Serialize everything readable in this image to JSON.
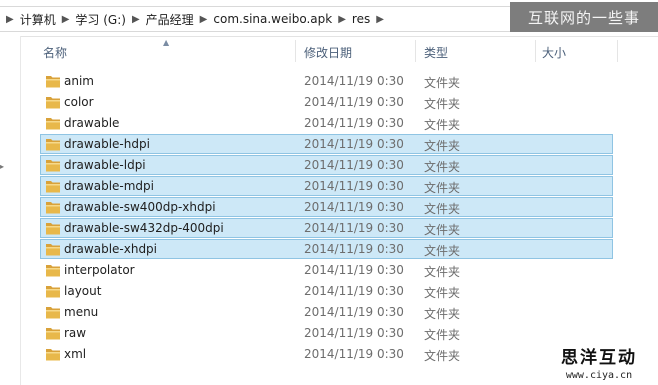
{
  "address": {
    "crumbs": [
      "计算机",
      "学习 (G:)",
      "产品经理",
      "com.sina.weibo.apk",
      "res"
    ]
  },
  "watermark_top": "互联网的一些事",
  "columns": {
    "name": "名称",
    "date": "修改日期",
    "type": "类型",
    "size": "大小"
  },
  "rows": [
    {
      "name": "anim",
      "date": "2014/11/19 0:30",
      "type": "文件夹",
      "selected": false
    },
    {
      "name": "color",
      "date": "2014/11/19 0:30",
      "type": "文件夹",
      "selected": false
    },
    {
      "name": "drawable",
      "date": "2014/11/19 0:30",
      "type": "文件夹",
      "selected": false
    },
    {
      "name": "drawable-hdpi",
      "date": "2014/11/19 0:30",
      "type": "文件夹",
      "selected": true
    },
    {
      "name": "drawable-ldpi",
      "date": "2014/11/19 0:30",
      "type": "文件夹",
      "selected": true
    },
    {
      "name": "drawable-mdpi",
      "date": "2014/11/19 0:30",
      "type": "文件夹",
      "selected": true
    },
    {
      "name": "drawable-sw400dp-xhdpi",
      "date": "2014/11/19 0:30",
      "type": "文件夹",
      "selected": true
    },
    {
      "name": "drawable-sw432dp-400dpi",
      "date": "2014/11/19 0:30",
      "type": "文件夹",
      "selected": true
    },
    {
      "name": "drawable-xhdpi",
      "date": "2014/11/19 0:30",
      "type": "文件夹",
      "selected": true
    },
    {
      "name": "interpolator",
      "date": "2014/11/19 0:30",
      "type": "文件夹",
      "selected": false
    },
    {
      "name": "layout",
      "date": "2014/11/19 0:30",
      "type": "文件夹",
      "selected": false
    },
    {
      "name": "menu",
      "date": "2014/11/19 0:30",
      "type": "文件夹",
      "selected": false
    },
    {
      "name": "raw",
      "date": "2014/11/19 0:30",
      "type": "文件夹",
      "selected": false
    },
    {
      "name": "xml",
      "date": "2014/11/19 0:30",
      "type": "文件夹",
      "selected": false
    }
  ],
  "watermark_br": {
    "title": "思洋互动",
    "url": "www.ciya.cn"
  },
  "colors": {
    "selection_bg": "#cde8f7",
    "selection_border": "#8fc4e3",
    "folder": "#e8b84a"
  }
}
